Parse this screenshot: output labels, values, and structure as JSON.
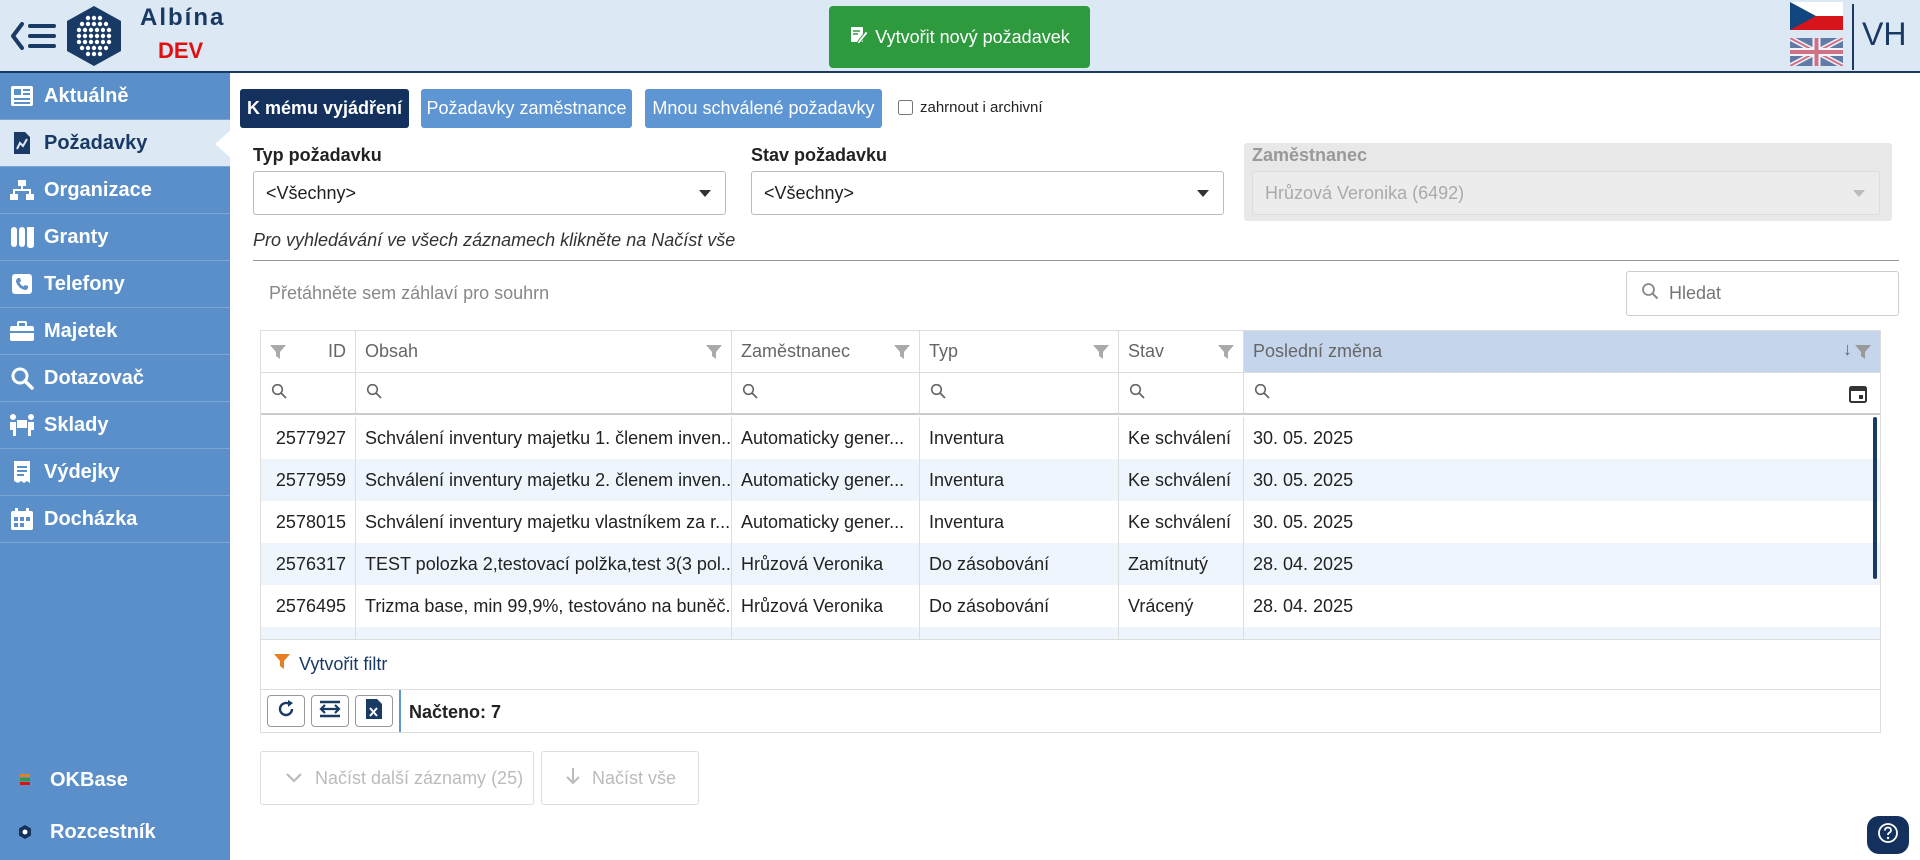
{
  "header": {
    "app_name": "Albína",
    "env_name": "DEV",
    "new_request_label": "Vytvořit nový požadavek",
    "user_initials": "VH",
    "languages": [
      "cs",
      "en"
    ]
  },
  "sidebar": {
    "items": [
      {
        "label": "Aktuálně",
        "icon": "newspaper-icon",
        "active": false
      },
      {
        "label": "Požadavky",
        "icon": "chart-document-icon",
        "active": true
      },
      {
        "label": "Organizace",
        "icon": "sitemap-icon",
        "active": false
      },
      {
        "label": "Granty",
        "icon": "flask-icon",
        "active": false
      },
      {
        "label": "Telefony",
        "icon": "phone-icon",
        "active": false
      },
      {
        "label": "Majetek",
        "icon": "briefcase-icon",
        "active": false
      },
      {
        "label": "Dotazovač",
        "icon": "search-icon",
        "active": false
      },
      {
        "label": "Sklady",
        "icon": "people-carry-icon",
        "active": false
      },
      {
        "label": "Výdejky",
        "icon": "receipt-icon",
        "active": false
      },
      {
        "label": "Docházka",
        "icon": "calendar-icon",
        "active": false
      }
    ],
    "bottom_links": [
      {
        "label": "OKBase",
        "icon": "okbase-icon"
      },
      {
        "label": "Rozcestník",
        "icon": "crossroads-icon"
      }
    ]
  },
  "tabs": {
    "items": [
      {
        "label": "K mému vyjádření",
        "active": true
      },
      {
        "label": "Požadavky zaměstnance",
        "active": false
      },
      {
        "label": "Mnou schválené požadavky",
        "active": false
      }
    ],
    "archive_label": "zahrnout i archivní",
    "archive_checked": false
  },
  "filters": {
    "type_label": "Typ požadavku",
    "type_value": "<Všechny>",
    "status_label": "Stav požadavku",
    "status_value": "<Všechny>",
    "employee_label": "Zaměstnanec",
    "employee_value": "Hrůzová Veronika (6492)",
    "hint": "Pro vyhledávání ve všech záznamech klikněte na Načíst vše"
  },
  "grid": {
    "group_panel_text": "Přetáhněte sem záhlaví pro souhrn",
    "search_placeholder": "Hledat",
    "columns": [
      "ID",
      "Obsah",
      "Zaměstnanec",
      "Typ",
      "Stav",
      "Poslední změna"
    ],
    "sorted_column": "Poslední změna",
    "sort_direction": "descending",
    "rows": [
      {
        "id": "2577927",
        "content": "Schválení inventury majetku 1. členem inven...",
        "employee": "Automaticky gener...",
        "type": "Inventura",
        "status": "Ke schválení",
        "changed": "30. 05. 2025"
      },
      {
        "id": "2577959",
        "content": "Schválení inventury majetku 2. členem inven...",
        "employee": "Automaticky gener...",
        "type": "Inventura",
        "status": "Ke schválení",
        "changed": "30. 05. 2025"
      },
      {
        "id": "2578015",
        "content": "Schválení inventury majetku vlastníkem za r...",
        "employee": "Automaticky gener...",
        "type": "Inventura",
        "status": "Ke schválení",
        "changed": "30. 05. 2025"
      },
      {
        "id": "2576317",
        "content": "TEST polozka 2,testovací polžka,test 3(3 pol...",
        "employee": "Hrůzová Veronika",
        "type": "Do zásobování",
        "status": "Zamítnutý",
        "changed": "28. 04. 2025"
      },
      {
        "id": "2576495",
        "content": "Trizma base, min 99,9%, testováno na buněč...",
        "employee": "Hrůzová Veronika",
        "type": "Do zásobování",
        "status": "Vrácený",
        "changed": "28. 04. 2025"
      }
    ],
    "create_filter_label": "Vytvořit filtr",
    "loaded_text": "Načteno: 7"
  },
  "pagination": {
    "load_more_label": "Načíst další záznamy (25)",
    "load_all_label": "Načíst vše"
  },
  "colors": {
    "header_bg": "#dce8f4",
    "sidebar_bg": "#5b8fc9",
    "primary_dark": "#13315c",
    "tab_inactive": "#5e95d3",
    "success_green": "#2e9a3e",
    "env_red": "#e01010",
    "row_alt": "#eef5fd",
    "sorted_header": "#c5d6ec"
  }
}
